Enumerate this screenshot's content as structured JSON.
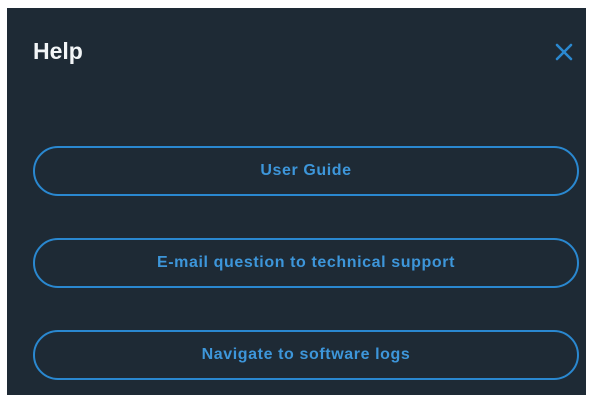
{
  "dialog": {
    "title": "Help",
    "close_icon": "close-icon",
    "accent_color": "#2a88d0",
    "background_color": "#1e2a35",
    "buttons": [
      {
        "label": "User Guide"
      },
      {
        "label": "E-mail question to technical support"
      },
      {
        "label": "Navigate to software logs"
      }
    ]
  }
}
